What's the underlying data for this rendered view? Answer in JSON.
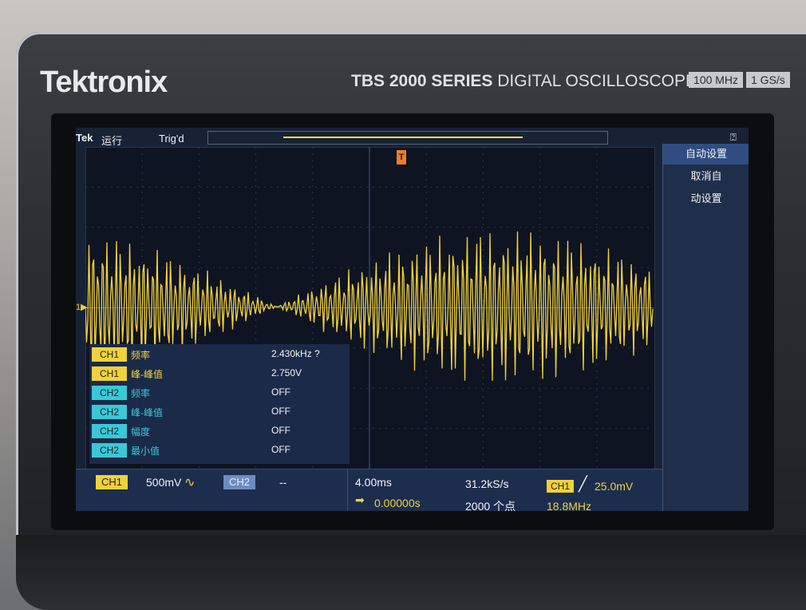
{
  "brand": "Tektronix",
  "series_bold": "TBS 2000 SERIES",
  "series_rest": "DIGITAL OSCILLOSCOPE",
  "spec_bandwidth": "100 MHz",
  "spec_rate": "1 GS/s",
  "top": {
    "logo": "Tek",
    "run": "运行",
    "trig_state": "Trig'd"
  },
  "menu": {
    "help_icon": "question-circle-icon",
    "items": [
      "自动设置",
      "取消自",
      "动设置"
    ]
  },
  "channel_marker": "1▶",
  "trigger_marker": "T",
  "measurements": [
    {
      "channel": "CH1",
      "name": "频率",
      "value": "2.430kHz ?"
    },
    {
      "channel": "CH1",
      "name": "峰-峰值",
      "value": "2.750V"
    },
    {
      "channel": "CH2",
      "name": "频率",
      "value": "OFF"
    },
    {
      "channel": "CH2",
      "name": "峰-峰值",
      "value": "OFF"
    },
    {
      "channel": "CH2",
      "name": "幅度",
      "value": "OFF"
    },
    {
      "channel": "CH2",
      "name": "最小值",
      "value": "OFF"
    }
  ],
  "bottom": {
    "ch1_label": "CH1",
    "ch1_scale": "500mV",
    "ch1_coupling_icon": "ac-coupling-icon",
    "ch2_label": "CH2",
    "ch2_scale": "--",
    "timebase": "4.00ms",
    "position": "0.00000s",
    "sample_rate": "31.2kS/s",
    "record_length": "2000 个点",
    "trig_source": "CH1",
    "trig_level": "25.0mV",
    "trig_freq": "18.8MHz"
  },
  "colors": {
    "ch1": "#f2d23a",
    "ch2": "#3ac8d8",
    "trigger": "#f07c2a"
  }
}
